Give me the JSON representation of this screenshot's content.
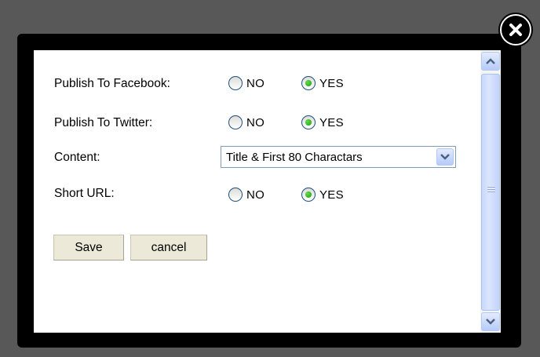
{
  "close": {
    "icon": "close-icon"
  },
  "form": {
    "facebook": {
      "label": "Publish To Facebook:",
      "no": "NO",
      "yes": "YES",
      "selected": "YES"
    },
    "twitter": {
      "label": "Publish To Twitter:",
      "no": "NO",
      "yes": "YES",
      "selected": "YES"
    },
    "content": {
      "label": "Content:",
      "value": "Title & First 80 Charactars"
    },
    "short_url": {
      "label": "Short URL:",
      "no": "NO",
      "yes": "YES",
      "selected": "YES"
    }
  },
  "buttons": {
    "save": "Save",
    "cancel": "cancel"
  },
  "colors": {
    "backdrop": "#585858",
    "frame": "#000000",
    "radio_dot": "#1b9f12",
    "scroll_blue": "#c9d7fc"
  }
}
